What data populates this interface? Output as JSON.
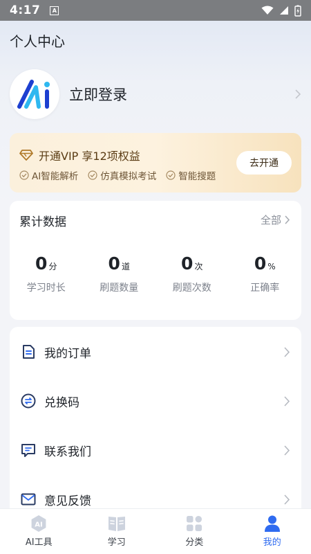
{
  "status_bar": {
    "time": "4:17",
    "notif_glyph": "A"
  },
  "header": {
    "title": "个人中心"
  },
  "profile": {
    "login_label": "立即登录",
    "avatar_logo": "Ai"
  },
  "vip": {
    "title": "开通VIP 享12项权益",
    "benefits": [
      "AI智能解析",
      "仿真模拟考试",
      "智能搜题"
    ],
    "button_label": "去开通",
    "accent": "#b07a2a"
  },
  "stats": {
    "title": "累计数据",
    "all_label": "全部",
    "items": [
      {
        "value": "0",
        "unit": "分",
        "label": "学习时长"
      },
      {
        "value": "0",
        "unit": "道",
        "label": "刷题数量"
      },
      {
        "value": "0",
        "unit": "次",
        "label": "刷题次数"
      },
      {
        "value": "0",
        "unit": "%",
        "label": "正确率"
      }
    ]
  },
  "menu": {
    "items": [
      {
        "label": "我的订单",
        "icon": "order-icon"
      },
      {
        "label": "兑换码",
        "icon": "exchange-icon"
      },
      {
        "label": "联系我们",
        "icon": "chat-icon"
      },
      {
        "label": "意见反馈",
        "icon": "mail-icon"
      }
    ]
  },
  "bottom_nav": {
    "items": [
      {
        "label": "AI工具",
        "icon": "ai-icon",
        "icon_text": "AI"
      },
      {
        "label": "学习",
        "icon": "book-icon"
      },
      {
        "label": "分类",
        "icon": "grid-icon"
      },
      {
        "label": "我的",
        "icon": "user-icon"
      }
    ],
    "active_color": "#2f6bf0"
  }
}
